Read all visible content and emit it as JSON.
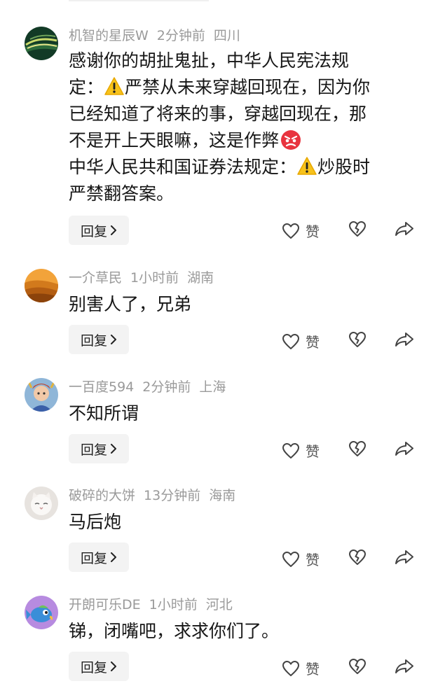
{
  "comments": [
    {
      "username": "机智的星辰W",
      "time": "2分钟前",
      "location": "四川",
      "lines": [
        [
          "感谢你的胡扯鬼扯，中华人民宪法规",
          "",
          ""
        ],
        [
          "定：",
          "严禁从未来穿越回现在，因为你",
          ""
        ],
        [
          "已经知道了将来的事，穿越回现在，那",
          "",
          ""
        ],
        [
          "不是开上天眼嘛，这是作弊",
          "",
          ""
        ],
        [
          "中华人民共和国证券法规定：",
          "炒股时",
          ""
        ],
        [
          "严禁翻答案。",
          "",
          ""
        ]
      ],
      "reply_label": "回复",
      "like_label": "赞"
    },
    {
      "username": "一介草民",
      "time": "1小时前",
      "location": "湖南",
      "text": "别害人了，兄弟",
      "reply_label": "回复",
      "like_label": "赞"
    },
    {
      "username": "一百度594",
      "time": "2分钟前",
      "location": "上海",
      "text": "不知所谓",
      "reply_label": "回复",
      "like_label": "赞"
    },
    {
      "username": "破碎的大饼",
      "time": "13分钟前",
      "location": "海南",
      "text": "马后炮",
      "reply_label": "回复",
      "like_label": "赞"
    },
    {
      "username": "开朗可乐DE",
      "time": "1小时前",
      "location": "河北",
      "text": "锑，闭嘴吧，求求你们了。",
      "reply_label": "回复",
      "like_label": "赞"
    }
  ],
  "icons": {
    "warning": "warning-icon",
    "angry": "angry-face-icon",
    "heart": "heart-outline-icon",
    "broken_heart": "broken-heart-icon",
    "share": "share-arrow-icon",
    "chevron": "chevron-right-icon"
  },
  "colors": {
    "text": "#161616",
    "meta": "#9a9a9a",
    "reply_bg": "#f3f3f3",
    "icon": "#444444"
  }
}
